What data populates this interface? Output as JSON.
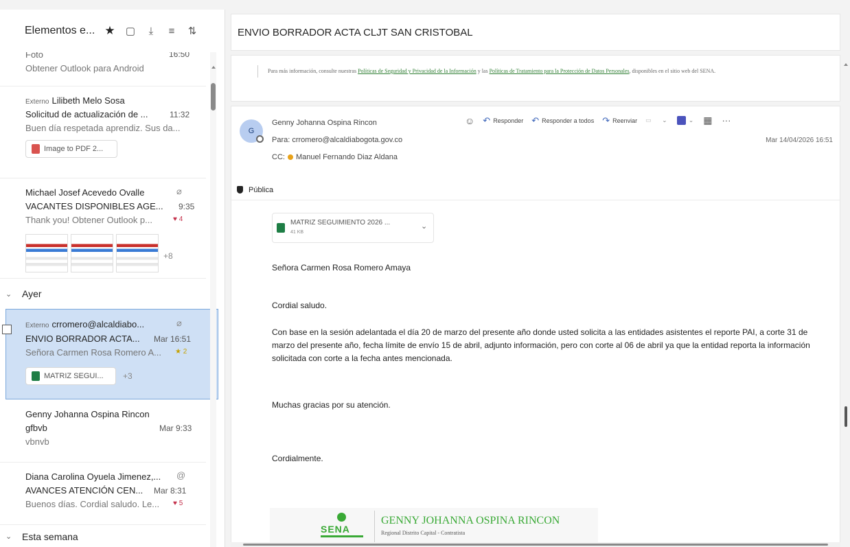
{
  "list": {
    "title": "Elementos e...",
    "items": [
      {
        "line1": "Foto",
        "line2": "Obtener Outlook para Android",
        "time": "16:50"
      },
      {
        "tag": "Externo",
        "sender": "Lilibeth Melo Sosa",
        "subject": "Solicitud de actualización de ...",
        "time": "11:32",
        "preview": "Buen día respetada aprendiz. Sus da...",
        "attachment": "Image to PDF 2..."
      },
      {
        "sender": "Michael Josef Acevedo Ovalle",
        "subject": "VACANTES DISPONIBLES AGE...",
        "time": "9:35",
        "preview": "Thank you! Obtener Outlook p...",
        "badge": "4",
        "more": "+8"
      },
      {
        "tag": "Externo",
        "sender": "crromero@alcaldiabo...",
        "subject": "ENVIO BORRADOR ACTA...",
        "time": "Mar 16:51",
        "preview": "Señora Carmen Rosa Romero A...",
        "badge": "2",
        "attachment": "MATRIZ SEGUI...",
        "more": "+3"
      },
      {
        "sender": "Genny Johanna Ospina Rincon",
        "subject": "gfbvb",
        "time": "Mar 9:33",
        "preview": "vbnvb"
      },
      {
        "sender": "Diana Carolina Oyuela Jimenez,...",
        "subject": "AVANCES ATENCIÓN CEN...",
        "time": "Mar 8:31",
        "preview": "Buenos días. Cordial saludo. Le...",
        "badge": "5"
      }
    ],
    "groups": {
      "yesterday": "Ayer",
      "this_week": "Esta semana"
    }
  },
  "reading": {
    "subject": "ENVIO BORRADOR ACTA CLJT SAN CRISTOBAL",
    "quoted": {
      "prefix": "Para más información, consulte nuestras",
      "link1": "Políticas de Seguridad y Privacidad de la Información",
      "mid": "y las",
      "link2": "Políticas de Tratamiento para la Protección de Datos Personales",
      "suffix": ", disponibles en el sitio web del SENA."
    },
    "avatar": "G",
    "sender": "Genny Johanna Ospina Rincon",
    "to_label": "Para:",
    "to": "crromero@alcaldiabogota.gov.co",
    "cc_label": "CC:",
    "cc": "Manuel Fernando Diaz Aldana",
    "date": "Mar 14/04/2026 16:51",
    "actions": {
      "reply": "Responder",
      "reply_all": "Responder a todos",
      "forward": "Reenviar"
    },
    "sensitivity": "Pública",
    "attachment": {
      "name": "MATRIZ SEGUIMIENTO 2026 ...",
      "size": "41 KB"
    },
    "body": {
      "greeting_name": "Señora Carmen Rosa Romero Amaya",
      "salutation": "Cordial saludo.",
      "paragraph": "Con base en la sesión adelantada el día 20 de marzo del presente año donde usted solicita a las entidades asistentes el reporte PAI, a corte 31 de marzo del presente año, fecha límite de envío 15 de abril, adjunto información, pero con corte al 06 de abril ya que la entidad reporta la información solicitada con corte a la fecha antes mencionada.",
      "thanks": "Muchas gracias por su atención.",
      "closing": "Cordialmente."
    },
    "signature": {
      "logo": "SENA",
      "name": "GENNY JOHANNA OSPINA RINCON",
      "role": "Regional Distrito Capital - Contratista"
    }
  }
}
